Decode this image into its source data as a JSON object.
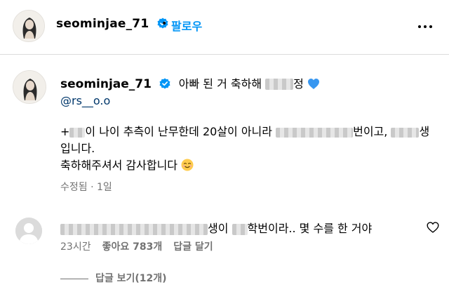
{
  "header": {
    "username": "seominjae_71",
    "separator": "•",
    "follow_label": "팔로우",
    "more_icon": "more-horizontal-icon"
  },
  "caption": {
    "username": "seominjae_71",
    "text_prefix": "아빠 된 거 축하해 ",
    "text_suffix": "정",
    "heart_color": "#3897f0",
    "mention": "@rs__o.o",
    "line1_a": "+",
    "line1_b": "이 나이 추측이 난무한데 20살이 아니라 ",
    "line1_c": "번이고, ",
    "line1_d": "생",
    "line2": "입니다.",
    "line3": "축하해주셔서 감사합니다",
    "edited": "수정됨",
    "dot": "·",
    "time": "1일"
  },
  "comment": {
    "text_a": "생이 ",
    "text_b": "학번이라.. 몇 수를 한 거야",
    "time": "23시간",
    "likes": "좋아요 783개",
    "reply": "답글 달기",
    "view_replies": "답글 보기(12개)"
  },
  "colors": {
    "link_blue": "#0095f6",
    "mention_blue": "#00376b",
    "secondary_text": "#737373",
    "divider": "#dbdbdb"
  }
}
